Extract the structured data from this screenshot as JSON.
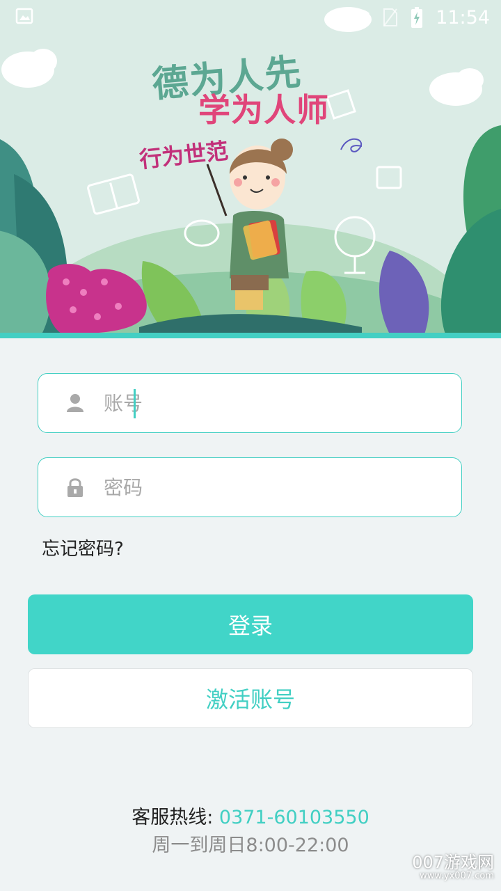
{
  "status_bar": {
    "time": "11:54"
  },
  "hero": {
    "slogan_line1": "德为人先",
    "slogan_line2": "学为人师",
    "slogan_line3": "行为世范"
  },
  "form": {
    "account_placeholder": "账号",
    "password_placeholder": "密码",
    "forgot_label": "忘记密码?"
  },
  "buttons": {
    "login_label": "登录",
    "activate_label": "激活账号"
  },
  "footer": {
    "hotline_label": "客服热线: ",
    "hotline_number": "0371-60103550",
    "hours": "周一到周日8:00-22:00"
  },
  "watermark": {
    "brand": "007游戏网",
    "url": "www.yx007.com"
  },
  "colors": {
    "accent": "#41d5c8",
    "background": "#eff3f4"
  }
}
